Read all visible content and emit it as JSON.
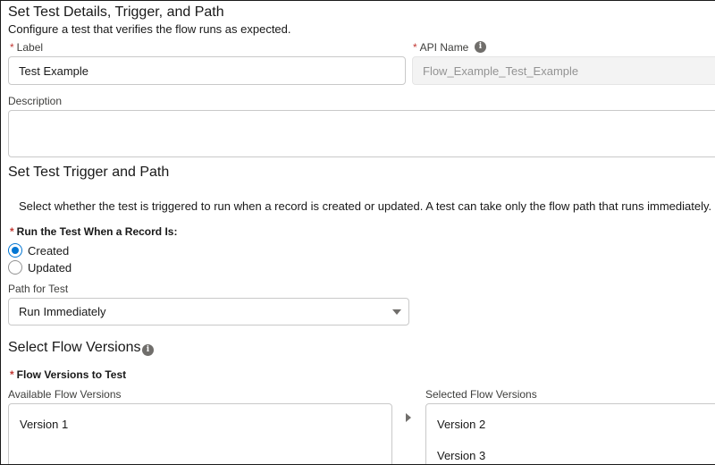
{
  "details": {
    "title": "Set Test Details, Trigger, and Path",
    "subtitle": "Configure a test that verifies the flow runs as expected.",
    "label_field": {
      "label": "Label",
      "value": "Test Example"
    },
    "api_name_field": {
      "label": "API Name",
      "value": "Flow_Example_Test_Example"
    },
    "description_field": {
      "label": "Description",
      "value": ""
    }
  },
  "trigger": {
    "title": "Set Test Trigger and Path",
    "help_text": "Select whether the test is triggered to run when a record is created or updated. A test can take only the flow path that runs immediately.",
    "run_when_label": "Run the Test When a Record Is:",
    "options": [
      {
        "label": "Created",
        "checked": true
      },
      {
        "label": "Updated",
        "checked": false
      }
    ],
    "path_label": "Path for Test",
    "path_value": "Run Immediately"
  },
  "versions": {
    "title": "Select Flow Versions",
    "to_test_label": "Flow Versions to Test",
    "available_label": "Available Flow Versions",
    "available": [
      "Version 1"
    ],
    "selected_label": "Selected Flow Versions",
    "selected": [
      "Version 2",
      "Version 3"
    ]
  },
  "required_marker": "*",
  "info_glyph": "i",
  "colors": {
    "accent": "#0176d3",
    "required": "#c23934"
  }
}
